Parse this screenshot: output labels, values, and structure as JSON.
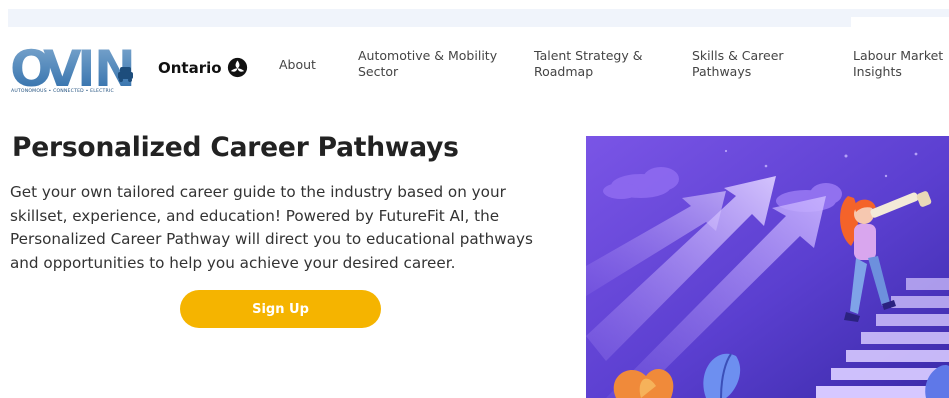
{
  "logo": {
    "letters": [
      "O",
      "V",
      "I",
      "N"
    ],
    "tagline": "AUTONOMOUS • CONNECTED • ELECTRIC"
  },
  "ontario": {
    "label": "Ontario"
  },
  "nav": {
    "about": [
      "About"
    ],
    "automotive": [
      "Automotive & Mobility",
      "Sector"
    ],
    "talent": [
      "Talent Strategy &",
      "Roadmap"
    ],
    "skills": [
      "Skills & Career",
      "Pathways"
    ],
    "labour": [
      "Labour Market",
      "Insights"
    ]
  },
  "hero": {
    "title": "Personalized Career Pathways",
    "description_lines": [
      "Get your own tailored career guide to the industry based on your",
      "skillset, experience, and education! Powered by FutureFit AI, the",
      "Personalized Career Pathway will direct you to educational pathways",
      "and opportunities to help you achieve your desired career."
    ],
    "cta_label": "Sign Up"
  },
  "colors": {
    "brand_blue": "#2a6aa8",
    "logo_dark": "#1d4d7c",
    "cta": "#f5b400",
    "illustration_bg": "#5b3fd0"
  }
}
